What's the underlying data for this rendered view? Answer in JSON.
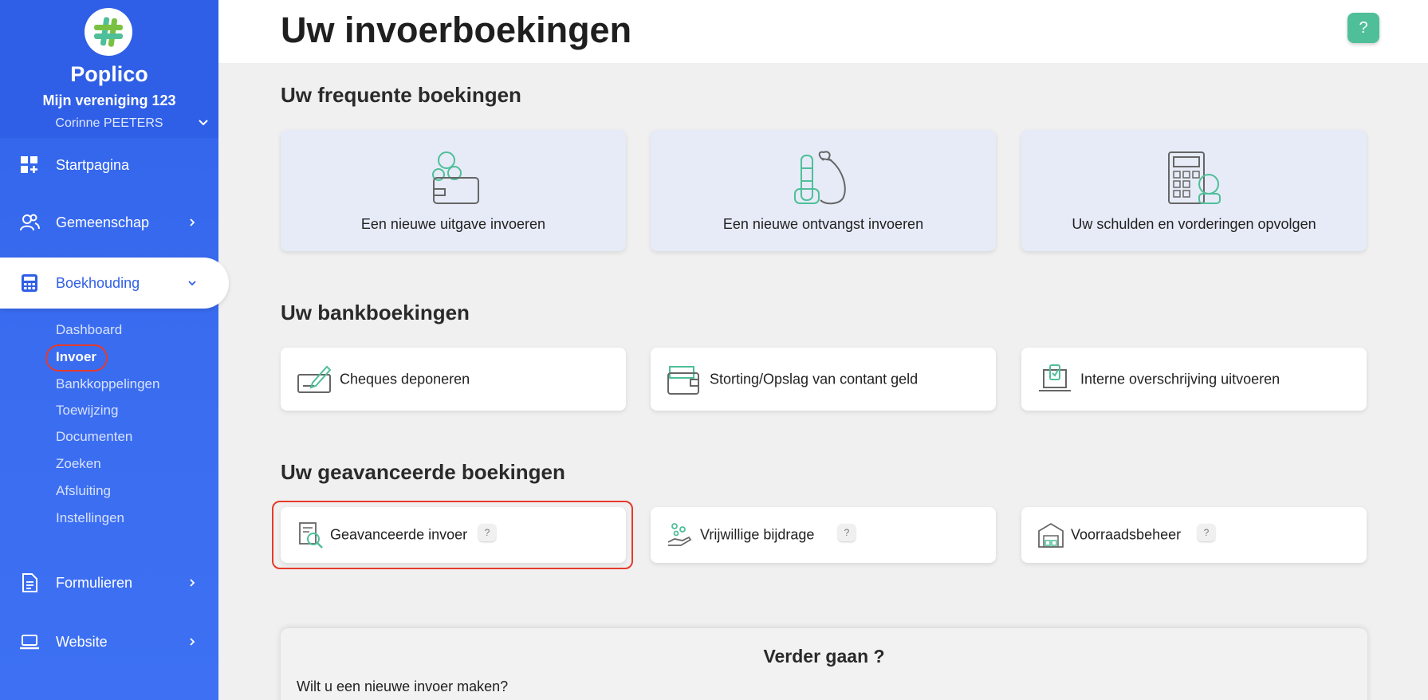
{
  "brand": {
    "name": "Poplico",
    "organization": "Mijn vereniging 123",
    "user": "Corinne PEETERS"
  },
  "nav": {
    "items": [
      {
        "label": "Startpagina",
        "icon": "dashboard-icon"
      },
      {
        "label": "Gemeenschap",
        "icon": "community-icon"
      },
      {
        "label": "Boekhouding",
        "icon": "calculator-icon"
      },
      {
        "label": "Formulieren",
        "icon": "document-icon"
      },
      {
        "label": "Website",
        "icon": "laptop-icon"
      }
    ],
    "sub_items": [
      "Dashboard",
      "Invoer",
      "Bankkoppelingen",
      "Toewijzing",
      "Documenten",
      "Zoeken",
      "Afsluiting",
      "Instellingen"
    ]
  },
  "page": {
    "title": "Uw invoerboekingen",
    "help": "?"
  },
  "frequent": {
    "title": "Uw frequente boekingen",
    "cards": [
      {
        "label": "Een nieuwe uitgave invoeren",
        "icon": "wallet-coins-icon"
      },
      {
        "label": "Een nieuwe ontvangst invoeren",
        "icon": "money-bag-icon"
      },
      {
        "label": "Uw schulden en vorderingen opvolgen",
        "icon": "calculator-coins-icon"
      }
    ]
  },
  "bank": {
    "title": "Uw bankboekingen",
    "cards": [
      {
        "label": "Cheques deponeren",
        "icon": "cheque-icon"
      },
      {
        "label": "Storting/Opslag van contant geld",
        "icon": "cash-wallet-icon"
      },
      {
        "label": "Interne overschrijving uitvoeren",
        "icon": "transfer-laptop-icon"
      }
    ]
  },
  "advanced": {
    "title": "Uw geavanceerde boekingen",
    "cards": [
      {
        "label": "Geavanceerde invoer",
        "icon": "advanced-search-icon",
        "badge": "?"
      },
      {
        "label": "Vrijwillige bijdrage",
        "icon": "donation-hand-icon",
        "badge": "?"
      },
      {
        "label": "Voorraadsbeheer",
        "icon": "warehouse-icon",
        "badge": "?"
      }
    ]
  },
  "continue": {
    "title": "Verder gaan ?",
    "question": "Wilt u een nieuwe invoer maken?"
  },
  "colors": {
    "sidebar": "#3163ea",
    "accent": "#4fbf99",
    "highlight": "#e43b2b",
    "card_light": "#e6ebf7"
  }
}
